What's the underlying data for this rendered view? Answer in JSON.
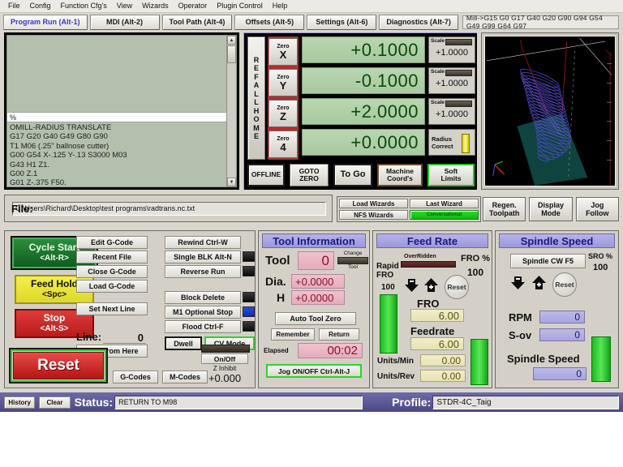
{
  "menu": {
    "items": [
      "File",
      "Config",
      "Function Cfg's",
      "View",
      "Wizards",
      "Operator",
      "Plugin Control",
      "Help"
    ]
  },
  "tabs": {
    "items": [
      {
        "label": "Program Run (Alt-1)",
        "active": true
      },
      {
        "label": "MDI (Alt-2)",
        "active": false
      },
      {
        "label": "Tool Path (Alt-4)",
        "active": false
      },
      {
        "label": "Offsets (Alt-5)",
        "active": false
      },
      {
        "label": "Settings (Alt-6)",
        "active": false
      },
      {
        "label": "Diagnostics (Alt-7)",
        "active": false
      }
    ],
    "modal_states": "Mill->G15   G0 G17 G40 G20 G90 G94 G54 G49 G99 G64 G97"
  },
  "gcode": {
    "marker": "%",
    "lines": [
      "OMILL-RADIUS TRANSLATE",
      "G17 G20 G40 G49 G80 G90",
      "T1 M06 (.25\" ballnose cutter)",
      "G00 G54 X-.125 Y-.13 S3000 M03",
      "G43 H1 Z1.",
      "G00 Z.1",
      "G01 Z-.375 F50."
    ]
  },
  "dro": {
    "ref_all_home": "REF ALL HOME",
    "axes": [
      {
        "zero_label": "Zero",
        "axis": "X",
        "value": "+0.1000",
        "scale_label": "Scale",
        "scale_value": "+1.0000"
      },
      {
        "zero_label": "Zero",
        "axis": "Y",
        "value": "-0.1000",
        "scale_label": "Scale",
        "scale_value": "+1.0000"
      },
      {
        "zero_label": "Zero",
        "axis": "Z",
        "value": "+2.0000",
        "scale_label": "Scale",
        "scale_value": "+1.0000"
      },
      {
        "zero_label": "Zero",
        "axis": "4",
        "value": "+0.0000",
        "scale_label": "Radius",
        "scale_value": "Correct"
      }
    ],
    "radius_correct_line1": "Radius",
    "radius_correct_line2": "Correct",
    "mode_buttons": [
      {
        "line1": "OFFLINE",
        "line2": ""
      },
      {
        "line1": "GOTO",
        "line2": "ZERO"
      },
      {
        "line1": "To Go",
        "line2": ""
      },
      {
        "line1": "Machine",
        "line2": "Coord's"
      },
      {
        "line1": "Soft",
        "line2": "Limits"
      }
    ]
  },
  "file": {
    "label": "File:",
    "path": "C:\\Users\\Richard\\Desktop\\test programs\\radtrans.nc.txt"
  },
  "wizards": {
    "load": "Load Wizards",
    "last": "Last Wizard",
    "nfs": "NFS Wizards",
    "conversational": "Conversational"
  },
  "view_buttons": [
    {
      "line1": "Regen.",
      "line2": "Toolpath"
    },
    {
      "line1": "Display",
      "line2": "Mode"
    },
    {
      "line1": "Jog",
      "line2": "Follow"
    }
  ],
  "control": {
    "cycle_start_l1": "Cycle Start",
    "cycle_start_l2": "<Alt-R>",
    "feed_hold_l1": "Feed Hold",
    "feed_hold_l2": "<Spc>",
    "stop_l1": "Stop",
    "stop_l2": "<Alt-S>",
    "reset": "Reset",
    "edit_gcode": "Edit G-Code",
    "recent_file": "Recent File",
    "close_gcode": "Close G-Code",
    "load_gcode": "Load G-Code",
    "set_next_line": "Set Next Line",
    "line_label": "Line:",
    "line_value": "0",
    "run_from_here": "Run From Here",
    "rewind": "Rewind Ctrl-W",
    "single_blk": "Single BLK Alt-N",
    "reverse_run": "Reverse Run",
    "block_delete": "Block Delete",
    "m1_optional_stop": "M1 Optional Stop",
    "flood": "Flood Ctrl-F",
    "dwell": "Dwell",
    "cv_mode": "CV Mode",
    "gcodes_btn": "G-Codes",
    "mcodes_btn": "M-Codes",
    "z_onoff": "On/Off",
    "z_inhibit_label": "Z Inhibit",
    "z_inhibit_value": "+0.000"
  },
  "tool_information": {
    "title": "Tool Information",
    "tool_label": "Tool",
    "tool_value": "0",
    "change_l1": "Change",
    "change_l2": "Tool",
    "dia_label": "Dia.",
    "dia_value": "+0.0000",
    "h_label": "H",
    "h_value": "+0.0000",
    "auto_tool_zero": "Auto Tool Zero",
    "remember": "Remember",
    "return": "Return",
    "elapsed_label": "Elapsed",
    "elapsed_value": "00:02",
    "jog_onoff": "Jog ON/OFF Ctrl-Alt-J"
  },
  "feed_rate": {
    "title": "Feed Rate",
    "overridden": "OverRidden",
    "fro_pct_label": "FRO %",
    "fro_pct_value": "100",
    "rapid_l1": "Rapid",
    "rapid_l2": "FRO",
    "rapid_value": "100",
    "reset": "Reset",
    "fro_label": "FRO",
    "fro_value": "6.00",
    "feedrate_label": "Feedrate",
    "feedrate_value": "6.00",
    "units_min_label": "Units/Min",
    "units_min_value": "0.00",
    "units_rev_label": "Units/Rev",
    "units_rev_value": "0.00"
  },
  "spindle_speed": {
    "title": "Spindle Speed",
    "spindle_cw": "Spindle CW F5",
    "sro_pct_label": "SRO %",
    "sro_pct_value": "100",
    "reset": "Reset",
    "rpm_label": "RPM",
    "rpm_value": "0",
    "sov_label": "S-ov",
    "sov_value": "0",
    "speed_label": "Spindle Speed",
    "speed_value": "0"
  },
  "statusbar": {
    "history": "History",
    "clear": "Clear",
    "status_label": "Status:",
    "status_value": "RETURN TO M98",
    "profile_label": "Profile:",
    "profile_value": "STDR-4C_Taig"
  }
}
